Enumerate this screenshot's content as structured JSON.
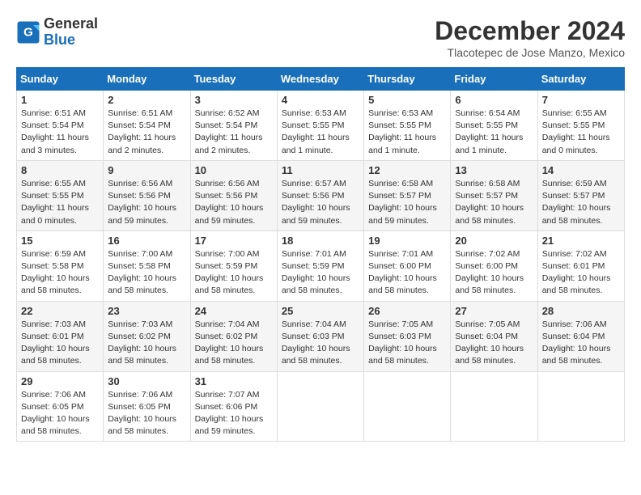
{
  "logo": {
    "general": "General",
    "blue": "Blue"
  },
  "title": {
    "month_year": "December 2024",
    "location": "Tlacotepec de Jose Manzo, Mexico"
  },
  "days_of_week": [
    "Sunday",
    "Monday",
    "Tuesday",
    "Wednesday",
    "Thursday",
    "Friday",
    "Saturday"
  ],
  "weeks": [
    [
      {
        "day": "1",
        "sunrise": "6:51 AM",
        "sunset": "5:54 PM",
        "daylight": "11 hours and 3 minutes."
      },
      {
        "day": "2",
        "sunrise": "6:51 AM",
        "sunset": "5:54 PM",
        "daylight": "11 hours and 2 minutes."
      },
      {
        "day": "3",
        "sunrise": "6:52 AM",
        "sunset": "5:54 PM",
        "daylight": "11 hours and 2 minutes."
      },
      {
        "day": "4",
        "sunrise": "6:53 AM",
        "sunset": "5:55 PM",
        "daylight": "11 hours and 1 minute."
      },
      {
        "day": "5",
        "sunrise": "6:53 AM",
        "sunset": "5:55 PM",
        "daylight": "11 hours and 1 minute."
      },
      {
        "day": "6",
        "sunrise": "6:54 AM",
        "sunset": "5:55 PM",
        "daylight": "11 hours and 1 minute."
      },
      {
        "day": "7",
        "sunrise": "6:55 AM",
        "sunset": "5:55 PM",
        "daylight": "11 hours and 0 minutes."
      }
    ],
    [
      {
        "day": "8",
        "sunrise": "6:55 AM",
        "sunset": "5:55 PM",
        "daylight": "11 hours and 0 minutes."
      },
      {
        "day": "9",
        "sunrise": "6:56 AM",
        "sunset": "5:56 PM",
        "daylight": "10 hours and 59 minutes."
      },
      {
        "day": "10",
        "sunrise": "6:56 AM",
        "sunset": "5:56 PM",
        "daylight": "10 hours and 59 minutes."
      },
      {
        "day": "11",
        "sunrise": "6:57 AM",
        "sunset": "5:56 PM",
        "daylight": "10 hours and 59 minutes."
      },
      {
        "day": "12",
        "sunrise": "6:58 AM",
        "sunset": "5:57 PM",
        "daylight": "10 hours and 59 minutes."
      },
      {
        "day": "13",
        "sunrise": "6:58 AM",
        "sunset": "5:57 PM",
        "daylight": "10 hours and 58 minutes."
      },
      {
        "day": "14",
        "sunrise": "6:59 AM",
        "sunset": "5:57 PM",
        "daylight": "10 hours and 58 minutes."
      }
    ],
    [
      {
        "day": "15",
        "sunrise": "6:59 AM",
        "sunset": "5:58 PM",
        "daylight": "10 hours and 58 minutes."
      },
      {
        "day": "16",
        "sunrise": "7:00 AM",
        "sunset": "5:58 PM",
        "daylight": "10 hours and 58 minutes."
      },
      {
        "day": "17",
        "sunrise": "7:00 AM",
        "sunset": "5:59 PM",
        "daylight": "10 hours and 58 minutes."
      },
      {
        "day": "18",
        "sunrise": "7:01 AM",
        "sunset": "5:59 PM",
        "daylight": "10 hours and 58 minutes."
      },
      {
        "day": "19",
        "sunrise": "7:01 AM",
        "sunset": "6:00 PM",
        "daylight": "10 hours and 58 minutes."
      },
      {
        "day": "20",
        "sunrise": "7:02 AM",
        "sunset": "6:00 PM",
        "daylight": "10 hours and 58 minutes."
      },
      {
        "day": "21",
        "sunrise": "7:02 AM",
        "sunset": "6:01 PM",
        "daylight": "10 hours and 58 minutes."
      }
    ],
    [
      {
        "day": "22",
        "sunrise": "7:03 AM",
        "sunset": "6:01 PM",
        "daylight": "10 hours and 58 minutes."
      },
      {
        "day": "23",
        "sunrise": "7:03 AM",
        "sunset": "6:02 PM",
        "daylight": "10 hours and 58 minutes."
      },
      {
        "day": "24",
        "sunrise": "7:04 AM",
        "sunset": "6:02 PM",
        "daylight": "10 hours and 58 minutes."
      },
      {
        "day": "25",
        "sunrise": "7:04 AM",
        "sunset": "6:03 PM",
        "daylight": "10 hours and 58 minutes."
      },
      {
        "day": "26",
        "sunrise": "7:05 AM",
        "sunset": "6:03 PM",
        "daylight": "10 hours and 58 minutes."
      },
      {
        "day": "27",
        "sunrise": "7:05 AM",
        "sunset": "6:04 PM",
        "daylight": "10 hours and 58 minutes."
      },
      {
        "day": "28",
        "sunrise": "7:06 AM",
        "sunset": "6:04 PM",
        "daylight": "10 hours and 58 minutes."
      }
    ],
    [
      {
        "day": "29",
        "sunrise": "7:06 AM",
        "sunset": "6:05 PM",
        "daylight": "10 hours and 58 minutes."
      },
      {
        "day": "30",
        "sunrise": "7:06 AM",
        "sunset": "6:05 PM",
        "daylight": "10 hours and 58 minutes."
      },
      {
        "day": "31",
        "sunrise": "7:07 AM",
        "sunset": "6:06 PM",
        "daylight": "10 hours and 59 minutes."
      },
      null,
      null,
      null,
      null
    ]
  ]
}
